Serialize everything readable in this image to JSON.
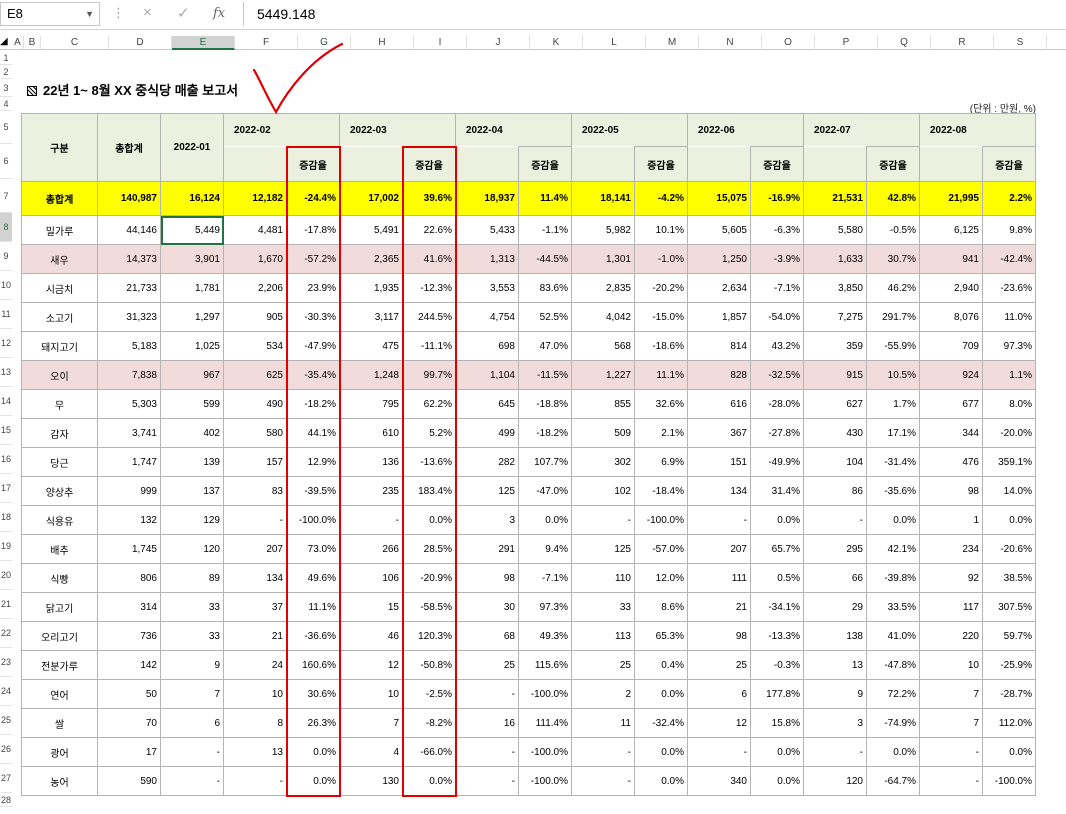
{
  "formula_bar": {
    "cell_ref": "E8",
    "formula_value": "5449.148",
    "cancel_icon": "×",
    "enter_icon": "✓",
    "fx_icon": "fx"
  },
  "columns": [
    "A",
    "B",
    "C",
    "D",
    "E",
    "F",
    "G",
    "H",
    "I",
    "J",
    "K",
    "L",
    "M",
    "N",
    "O",
    "P",
    "Q",
    "R",
    "S",
    "T"
  ],
  "rows": [
    "1",
    "2",
    "3",
    "4",
    "5",
    "6",
    "7",
    "8",
    "9",
    "10",
    "11",
    "12",
    "13",
    "14",
    "15",
    "16",
    "17",
    "18",
    "19",
    "20",
    "21",
    "22",
    "23",
    "24",
    "25",
    "26",
    "27",
    "28"
  ],
  "report": {
    "title": "22년 1~ 8월 XX 중식당 매출 보고서",
    "unit": "(단위 : 만원, %)",
    "header": {
      "category": "구분",
      "total": "총합계",
      "months": [
        "2022-01",
        "2022-02",
        "2022-03",
        "2022-04",
        "2022-05",
        "2022-06",
        "2022-07",
        "2022-08"
      ],
      "change": "증감율"
    },
    "total_row": {
      "label": "총합계",
      "values": [
        "140,987",
        "16,124",
        "12,182",
        "-24.4%",
        "17,002",
        "39.6%",
        "18,937",
        "11.4%",
        "18,141",
        "-4.2%",
        "15,075",
        "-16.9%",
        "21,531",
        "42.8%",
        "21,995",
        "2.2%"
      ]
    },
    "items": [
      {
        "label": "밀가루",
        "values": [
          "44,146",
          "5,449",
          "4,481",
          "-17.8%",
          "5,491",
          "22.6%",
          "5,433",
          "-1.1%",
          "5,982",
          "10.1%",
          "5,605",
          "-6.3%",
          "5,580",
          "-0.5%",
          "6,125",
          "9.8%"
        ]
      },
      {
        "label": "새우",
        "values": [
          "14,373",
          "3,901",
          "1,670",
          "-57.2%",
          "2,365",
          "41.6%",
          "1,313",
          "-44.5%",
          "1,301",
          "-1.0%",
          "1,250",
          "-3.9%",
          "1,633",
          "30.7%",
          "941",
          "-42.4%"
        ]
      },
      {
        "label": "시금치",
        "values": [
          "21,733",
          "1,781",
          "2,206",
          "23.9%",
          "1,935",
          "-12.3%",
          "3,553",
          "83.6%",
          "2,835",
          "-20.2%",
          "2,634",
          "-7.1%",
          "3,850",
          "46.2%",
          "2,940",
          "-23.6%"
        ]
      },
      {
        "label": "소고기",
        "values": [
          "31,323",
          "1,297",
          "905",
          "-30.3%",
          "3,117",
          "244.5%",
          "4,754",
          "52.5%",
          "4,042",
          "-15.0%",
          "1,857",
          "-54.0%",
          "7,275",
          "291.7%",
          "8,076",
          "11.0%"
        ]
      },
      {
        "label": "돼지고기",
        "values": [
          "5,183",
          "1,025",
          "534",
          "-47.9%",
          "475",
          "-11.1%",
          "698",
          "47.0%",
          "568",
          "-18.6%",
          "814",
          "43.2%",
          "359",
          "-55.9%",
          "709",
          "97.3%"
        ]
      },
      {
        "label": "오이",
        "values": [
          "7,838",
          "967",
          "625",
          "-35.4%",
          "1,248",
          "99.7%",
          "1,104",
          "-11.5%",
          "1,227",
          "11.1%",
          "828",
          "-32.5%",
          "915",
          "10.5%",
          "924",
          "1.1%"
        ]
      },
      {
        "label": "무",
        "values": [
          "5,303",
          "599",
          "490",
          "-18.2%",
          "795",
          "62.2%",
          "645",
          "-18.8%",
          "855",
          "32.6%",
          "616",
          "-28.0%",
          "627",
          "1.7%",
          "677",
          "8.0%"
        ]
      },
      {
        "label": "감자",
        "values": [
          "3,741",
          "402",
          "580",
          "44.1%",
          "610",
          "5.2%",
          "499",
          "-18.2%",
          "509",
          "2.1%",
          "367",
          "-27.8%",
          "430",
          "17.1%",
          "344",
          "-20.0%"
        ]
      },
      {
        "label": "당근",
        "values": [
          "1,747",
          "139",
          "157",
          "12.9%",
          "136",
          "-13.6%",
          "282",
          "107.7%",
          "302",
          "6.9%",
          "151",
          "-49.9%",
          "104",
          "-31.4%",
          "476",
          "359.1%"
        ]
      },
      {
        "label": "양상추",
        "values": [
          "999",
          "137",
          "83",
          "-39.5%",
          "235",
          "183.4%",
          "125",
          "-47.0%",
          "102",
          "-18.4%",
          "134",
          "31.4%",
          "86",
          "-35.6%",
          "98",
          "14.0%"
        ]
      },
      {
        "label": "식용유",
        "values": [
          "132",
          "129",
          "-",
          "-100.0%",
          "-",
          "0.0%",
          "3",
          "0.0%",
          "-",
          "-100.0%",
          "-",
          "0.0%",
          "-",
          "0.0%",
          "1",
          "0.0%"
        ]
      },
      {
        "label": "배추",
        "values": [
          "1,745",
          "120",
          "207",
          "73.0%",
          "266",
          "28.5%",
          "291",
          "9.4%",
          "125",
          "-57.0%",
          "207",
          "65.7%",
          "295",
          "42.1%",
          "234",
          "-20.6%"
        ]
      },
      {
        "label": "식빵",
        "values": [
          "806",
          "89",
          "134",
          "49.6%",
          "106",
          "-20.9%",
          "98",
          "-7.1%",
          "110",
          "12.0%",
          "111",
          "0.5%",
          "66",
          "-39.8%",
          "92",
          "38.5%"
        ]
      },
      {
        "label": "닭고기",
        "values": [
          "314",
          "33",
          "37",
          "11.1%",
          "15",
          "-58.5%",
          "30",
          "97.3%",
          "33",
          "8.6%",
          "21",
          "-34.1%",
          "29",
          "33.5%",
          "117",
          "307.5%"
        ]
      },
      {
        "label": "오리고기",
        "values": [
          "736",
          "33",
          "21",
          "-36.6%",
          "46",
          "120.3%",
          "68",
          "49.3%",
          "113",
          "65.3%",
          "98",
          "-13.3%",
          "138",
          "41.0%",
          "220",
          "59.7%"
        ]
      },
      {
        "label": "전분가루",
        "values": [
          "142",
          "9",
          "24",
          "160.6%",
          "12",
          "-50.8%",
          "25",
          "115.6%",
          "25",
          "0.4%",
          "25",
          "-0.3%",
          "13",
          "-47.8%",
          "10",
          "-25.9%"
        ]
      },
      {
        "label": "연어",
        "values": [
          "50",
          "7",
          "10",
          "30.6%",
          "10",
          "-2.5%",
          "-",
          "-100.0%",
          "2",
          "0.0%",
          "6",
          "177.8%",
          "9",
          "72.2%",
          "7",
          "-28.7%"
        ]
      },
      {
        "label": "쌀",
        "values": [
          "70",
          "6",
          "8",
          "26.3%",
          "7",
          "-8.2%",
          "16",
          "111.4%",
          "11",
          "-32.4%",
          "12",
          "15.8%",
          "3",
          "-74.9%",
          "7",
          "112.0%"
        ]
      },
      {
        "label": "광어",
        "values": [
          "17",
          "-",
          "13",
          "0.0%",
          "4",
          "-66.0%",
          "-",
          "-100.0%",
          "-",
          "0.0%",
          "-",
          "0.0%",
          "-",
          "0.0%",
          "-",
          "0.0%"
        ]
      },
      {
        "label": "농어",
        "values": [
          "590",
          "-",
          "-",
          "0.0%",
          "130",
          "0.0%",
          "-",
          "-100.0%",
          "-",
          "0.0%",
          "340",
          "0.0%",
          "120",
          "-64.7%",
          "-",
          "-100.0%"
        ]
      }
    ],
    "pink_rows": [
      1,
      5
    ]
  },
  "colors": {
    "header_bg": "#ebf1de",
    "total_bg": "#ffff00",
    "pink_bg": "#f2dcdb",
    "highlight_box": "#e00000",
    "excel_green": "#217346"
  }
}
